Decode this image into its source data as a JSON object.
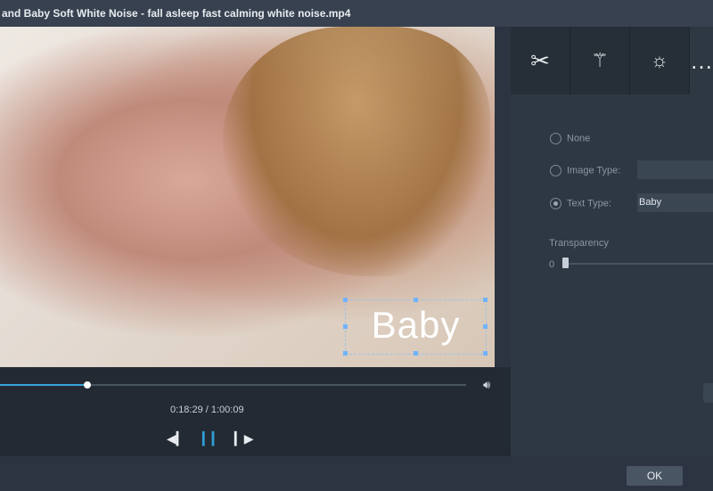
{
  "window": {
    "title": "and Baby Soft White Noise - fall asleep fast  calming white noise.mp4"
  },
  "video": {
    "overlay_text": "Baby"
  },
  "player": {
    "time": "0:18:29 / 1:00:09",
    "progress": 0.187
  },
  "panel": {
    "tabs": [
      "cut-icon",
      "magic-wand-icon",
      "brightness-icon",
      "more-icon"
    ],
    "watermark_options": {
      "none_label": "None",
      "image_type_label": "Image Type:",
      "image_type_value": "",
      "text_type_label": "Text Type:",
      "text_type_value": "Baby"
    },
    "transparency": {
      "label": "Transparency",
      "value": "0"
    }
  },
  "footer": {
    "ok_label": "OK"
  }
}
